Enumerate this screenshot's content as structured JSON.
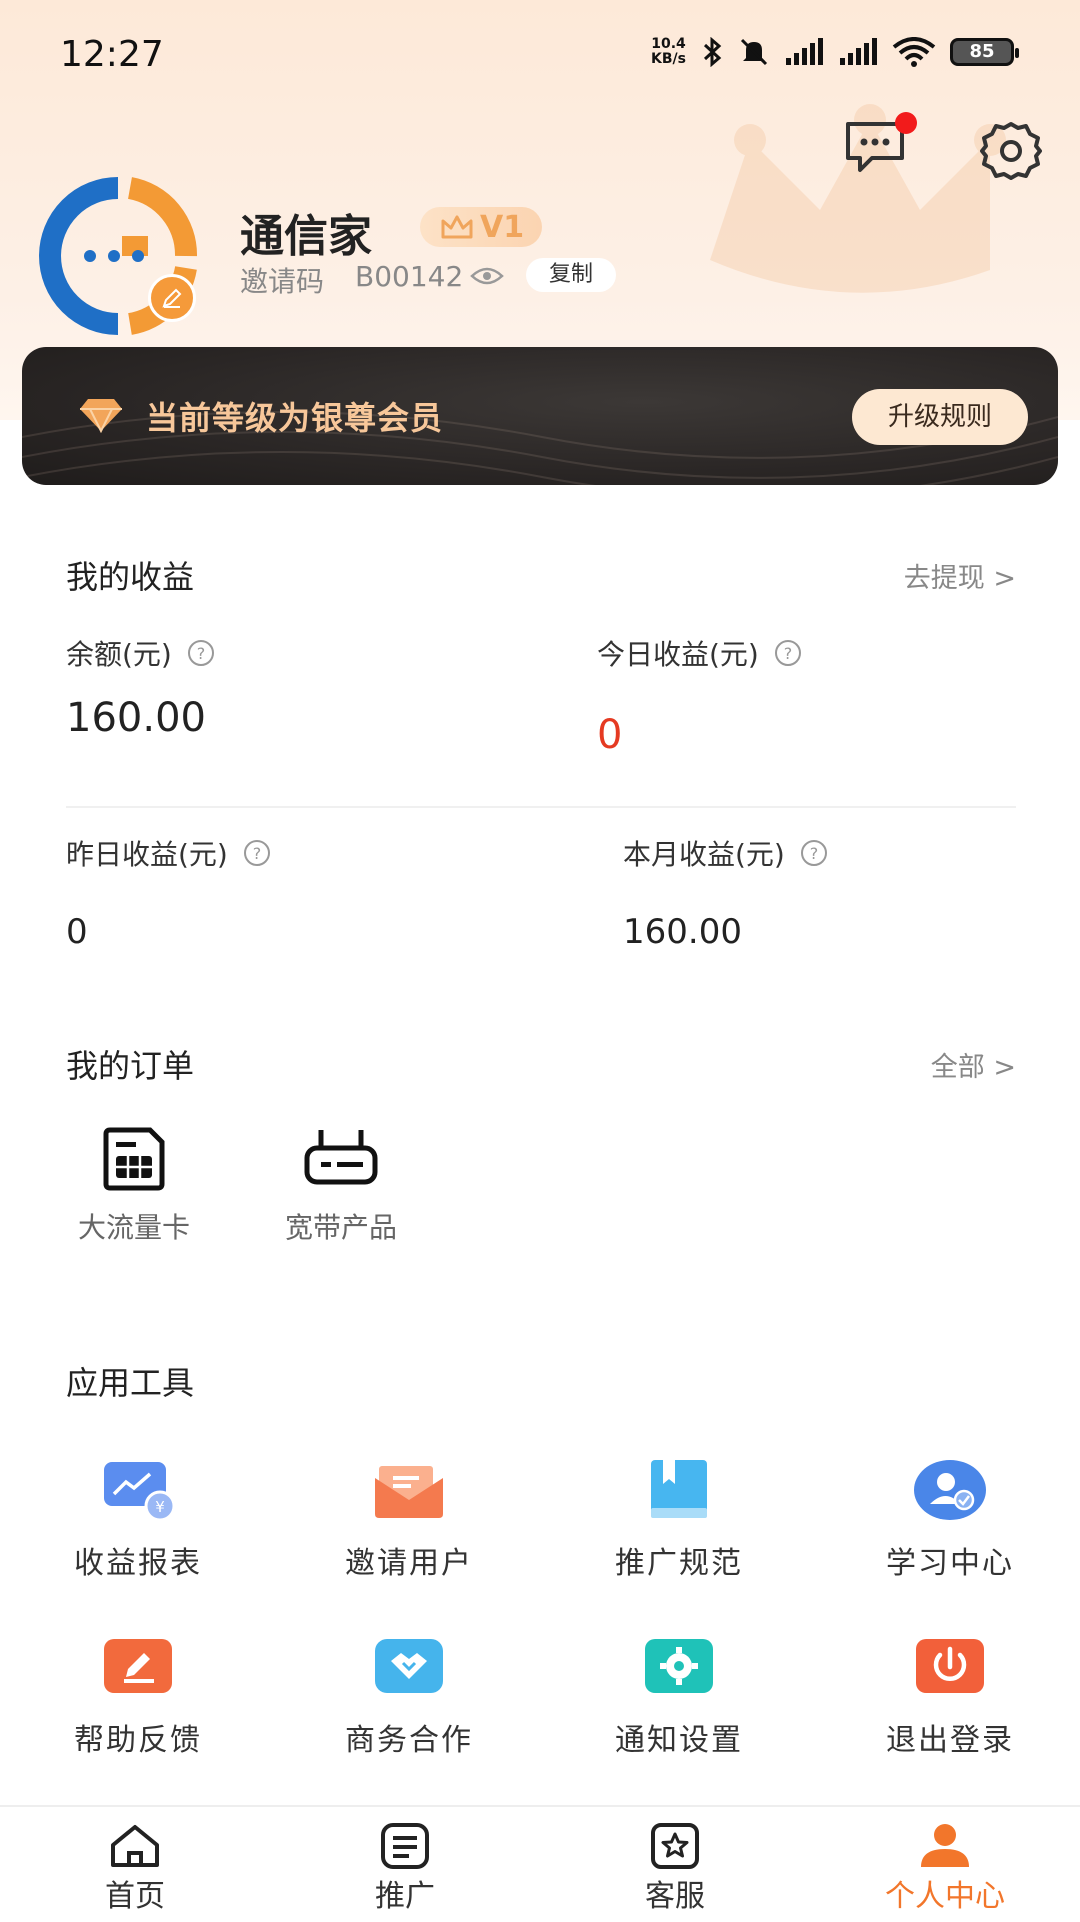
{
  "status": {
    "time": "12:27",
    "net_speed_top": "10.4",
    "net_speed_unit": "KB/s",
    "battery": "85"
  },
  "profile": {
    "name": "通信家",
    "level": "V1",
    "invite_label": "邀请码",
    "invite_code": "B00142",
    "copy_label": "复制"
  },
  "member": {
    "text": "当前等级为银尊会员",
    "upgrade_label": "升级规则"
  },
  "earnings": {
    "title": "我的收益",
    "link": "去提现 >",
    "balance_label": "余额(元)",
    "balance_value": "160.00",
    "today_label": "今日收益(元)",
    "today_value": "0",
    "yesterday_label": "昨日收益(元)",
    "yesterday_value": "0",
    "month_label": "本月收益(元)",
    "month_value": "160.00"
  },
  "orders": {
    "title": "我的订单",
    "link": "全部 >",
    "items": [
      {
        "label": "大流量卡",
        "icon": "sim-card-icon"
      },
      {
        "label": "宽带产品",
        "icon": "router-icon"
      }
    ]
  },
  "tools": {
    "title": "应用工具",
    "items": [
      {
        "label": "收益报表",
        "icon": "earnings-report-icon",
        "color": "#5b8def"
      },
      {
        "label": "邀请用户",
        "icon": "envelope-icon",
        "color": "#f47a4e"
      },
      {
        "label": "推广规范",
        "icon": "book-icon",
        "color": "#47b6f0"
      },
      {
        "label": "学习中心",
        "icon": "user-check-icon",
        "color": "#4a86e8"
      },
      {
        "label": "帮助反馈",
        "icon": "pencil-icon",
        "color": "#f26a3d"
      },
      {
        "label": "商务合作",
        "icon": "handshake-icon",
        "color": "#45b4ec"
      },
      {
        "label": "通知设置",
        "icon": "gear-badge-icon",
        "color": "#1fc2b8"
      },
      {
        "label": "退出登录",
        "icon": "power-icon",
        "color": "#f2603a"
      }
    ]
  },
  "tabs": [
    {
      "label": "首页",
      "icon": "home-icon"
    },
    {
      "label": "推广",
      "icon": "list-icon"
    },
    {
      "label": "客服",
      "icon": "star-icon"
    },
    {
      "label": "个人中心",
      "icon": "person-icon",
      "active": true
    }
  ],
  "colors": {
    "accent": "#f2762b",
    "today_value": "#e53a22",
    "member_text": "#f7c79a"
  }
}
